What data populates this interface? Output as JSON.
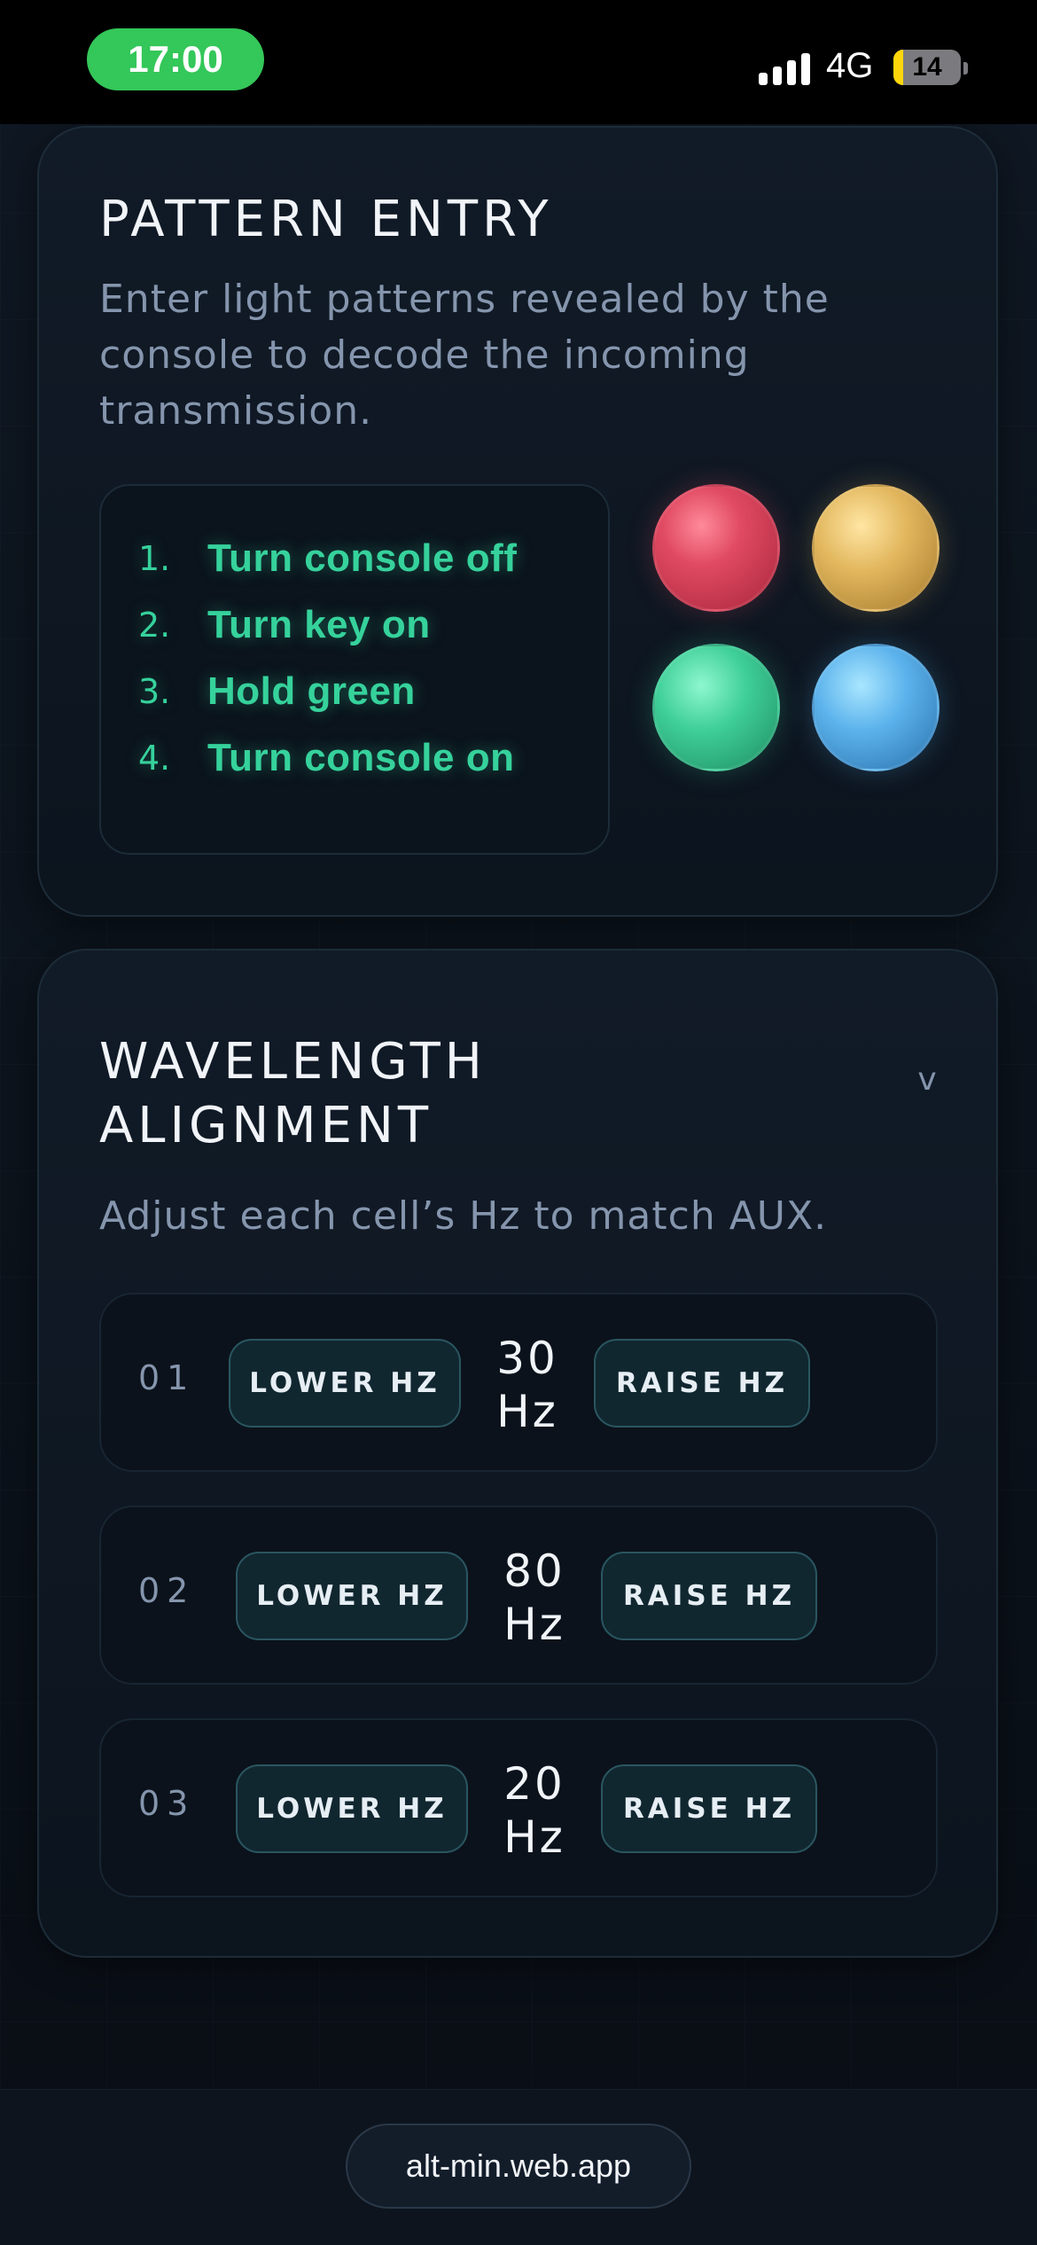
{
  "status_bar": {
    "time": "17:00",
    "network": "4G",
    "battery_level": "14",
    "battery_fraction": 0.14
  },
  "pattern_entry": {
    "title": "PATTERN ENTRY",
    "description": "Enter light patterns revealed by the console to decode the incoming transmission.",
    "steps": [
      {
        "num": "1.",
        "text": "Turn console off"
      },
      {
        "num": "2.",
        "text": "Turn key on"
      },
      {
        "num": "3.",
        "text": "Hold green"
      },
      {
        "num": "4.",
        "text": "Turn console on"
      }
    ],
    "orbs": {
      "red": "#e04a62",
      "gold": "#e2b75e",
      "green": "#3fcf98",
      "blue": "#5cb3ec"
    }
  },
  "wavelength_alignment": {
    "title": "WAVELENGTH ALIGNMENT",
    "chevron": "v",
    "description": "Adjust each cell’s Hz to match AUX.",
    "cells": [
      {
        "id": "01",
        "lower_label": "LOWER HZ",
        "value": "30",
        "unit": "Hz",
        "raise_label": "RAISE HZ"
      },
      {
        "id": "02",
        "lower_label": "LOWER HZ",
        "value": "80",
        "unit": "Hz",
        "raise_label": "RAISE HZ"
      },
      {
        "id": "03",
        "lower_label": "LOWER HZ",
        "value": "20",
        "unit": "Hz",
        "raise_label": "RAISE HZ"
      }
    ]
  },
  "browser": {
    "url": "alt-min.web.app"
  },
  "colors": {
    "accent_green": "#36d29c",
    "status_green": "#34c759",
    "button_border": "#2a5660"
  }
}
